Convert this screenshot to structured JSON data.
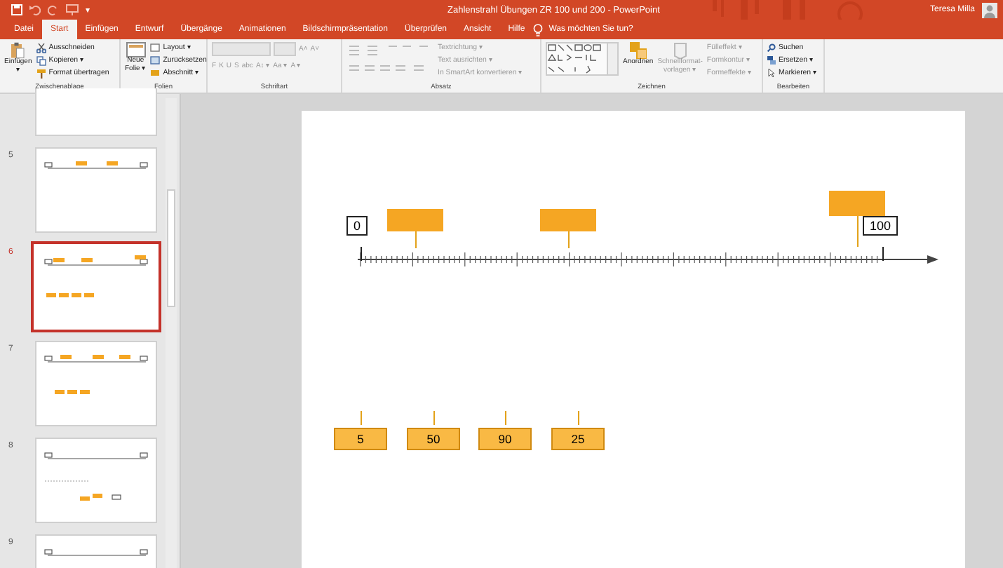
{
  "window": {
    "title": "Zahlenstrahl Übungen ZR 100 und 200  -  PowerPoint",
    "user": "Teresa Milla"
  },
  "quick_access": {
    "more": "▾"
  },
  "tabs": [
    {
      "label": "Datei",
      "selected": false
    },
    {
      "label": "Start",
      "selected": true
    },
    {
      "label": "Einfügen",
      "selected": false
    },
    {
      "label": "Entwurf",
      "selected": false
    },
    {
      "label": "Übergänge",
      "selected": false
    },
    {
      "label": "Animationen",
      "selected": false
    },
    {
      "label": "Bildschirmpräsentation",
      "selected": false
    },
    {
      "label": "Überprüfen",
      "selected": false
    },
    {
      "label": "Ansicht",
      "selected": false
    },
    {
      "label": "Hilfe",
      "selected": false
    }
  ],
  "tell_me": "Was möchten Sie tun?",
  "ribbon": {
    "clipboard": {
      "label": "Zwischenablage",
      "paste": "Einfügen",
      "paste_more": "▾",
      "cut": "Ausschneiden",
      "copy": "Kopieren",
      "copy_more": "▾",
      "format_painter": "Format übertragen"
    },
    "slides": {
      "label": "Folien",
      "new_slide": "Neue",
      "new_slide_2": "Folie ▾",
      "layout": "Layout ▾",
      "reset": "Zurücksetzen",
      "section": "Abschnitt ▾"
    },
    "font": {
      "label": "Schriftart",
      "buttons": [
        "F",
        "K",
        "U",
        "S",
        "abc",
        "A↕ ▾",
        "Aa ▾",
        "A ▾"
      ],
      "grow": "A˄",
      "shrink": "A˅"
    },
    "paragraph": {
      "label": "Absatz",
      "text_direction": "Textrichtung ▾",
      "align_text": "Text ausrichten ▾",
      "smartart": "In SmartArt konvertieren ▾"
    },
    "drawing": {
      "label": "Zeichnen",
      "arrange": "Anordnen",
      "quick_styles": "Schnellformat-",
      "quick_styles_2": "vorlagen ▾",
      "fill": "Fülleffekt ▾",
      "outline": "Formkontur ▾",
      "effects": "Formeffekte ▾"
    },
    "editing": {
      "label": "Bearbeiten",
      "find": "Suchen",
      "replace": "Ersetzen ▾",
      "select": "Markieren ▾"
    }
  },
  "thumbnails": [
    {
      "kind": "blank",
      "selected": false
    },
    {
      "number": "5",
      "kind": "line",
      "selected": false
    },
    {
      "number": "6",
      "kind": "answers",
      "selected": true
    },
    {
      "number": "7",
      "kind": "three",
      "selected": false
    },
    {
      "number": "8",
      "kind": "dashes",
      "selected": false
    },
    {
      "number": "9",
      "kind": "partial",
      "selected": false
    }
  ],
  "slide": {
    "start_label": "0",
    "end_label": "100",
    "markers": [
      {
        "kind": "low"
      },
      {
        "kind": "low"
      },
      {
        "kind": "high"
      }
    ],
    "answers": [
      "5",
      "50",
      "90",
      "25"
    ]
  }
}
